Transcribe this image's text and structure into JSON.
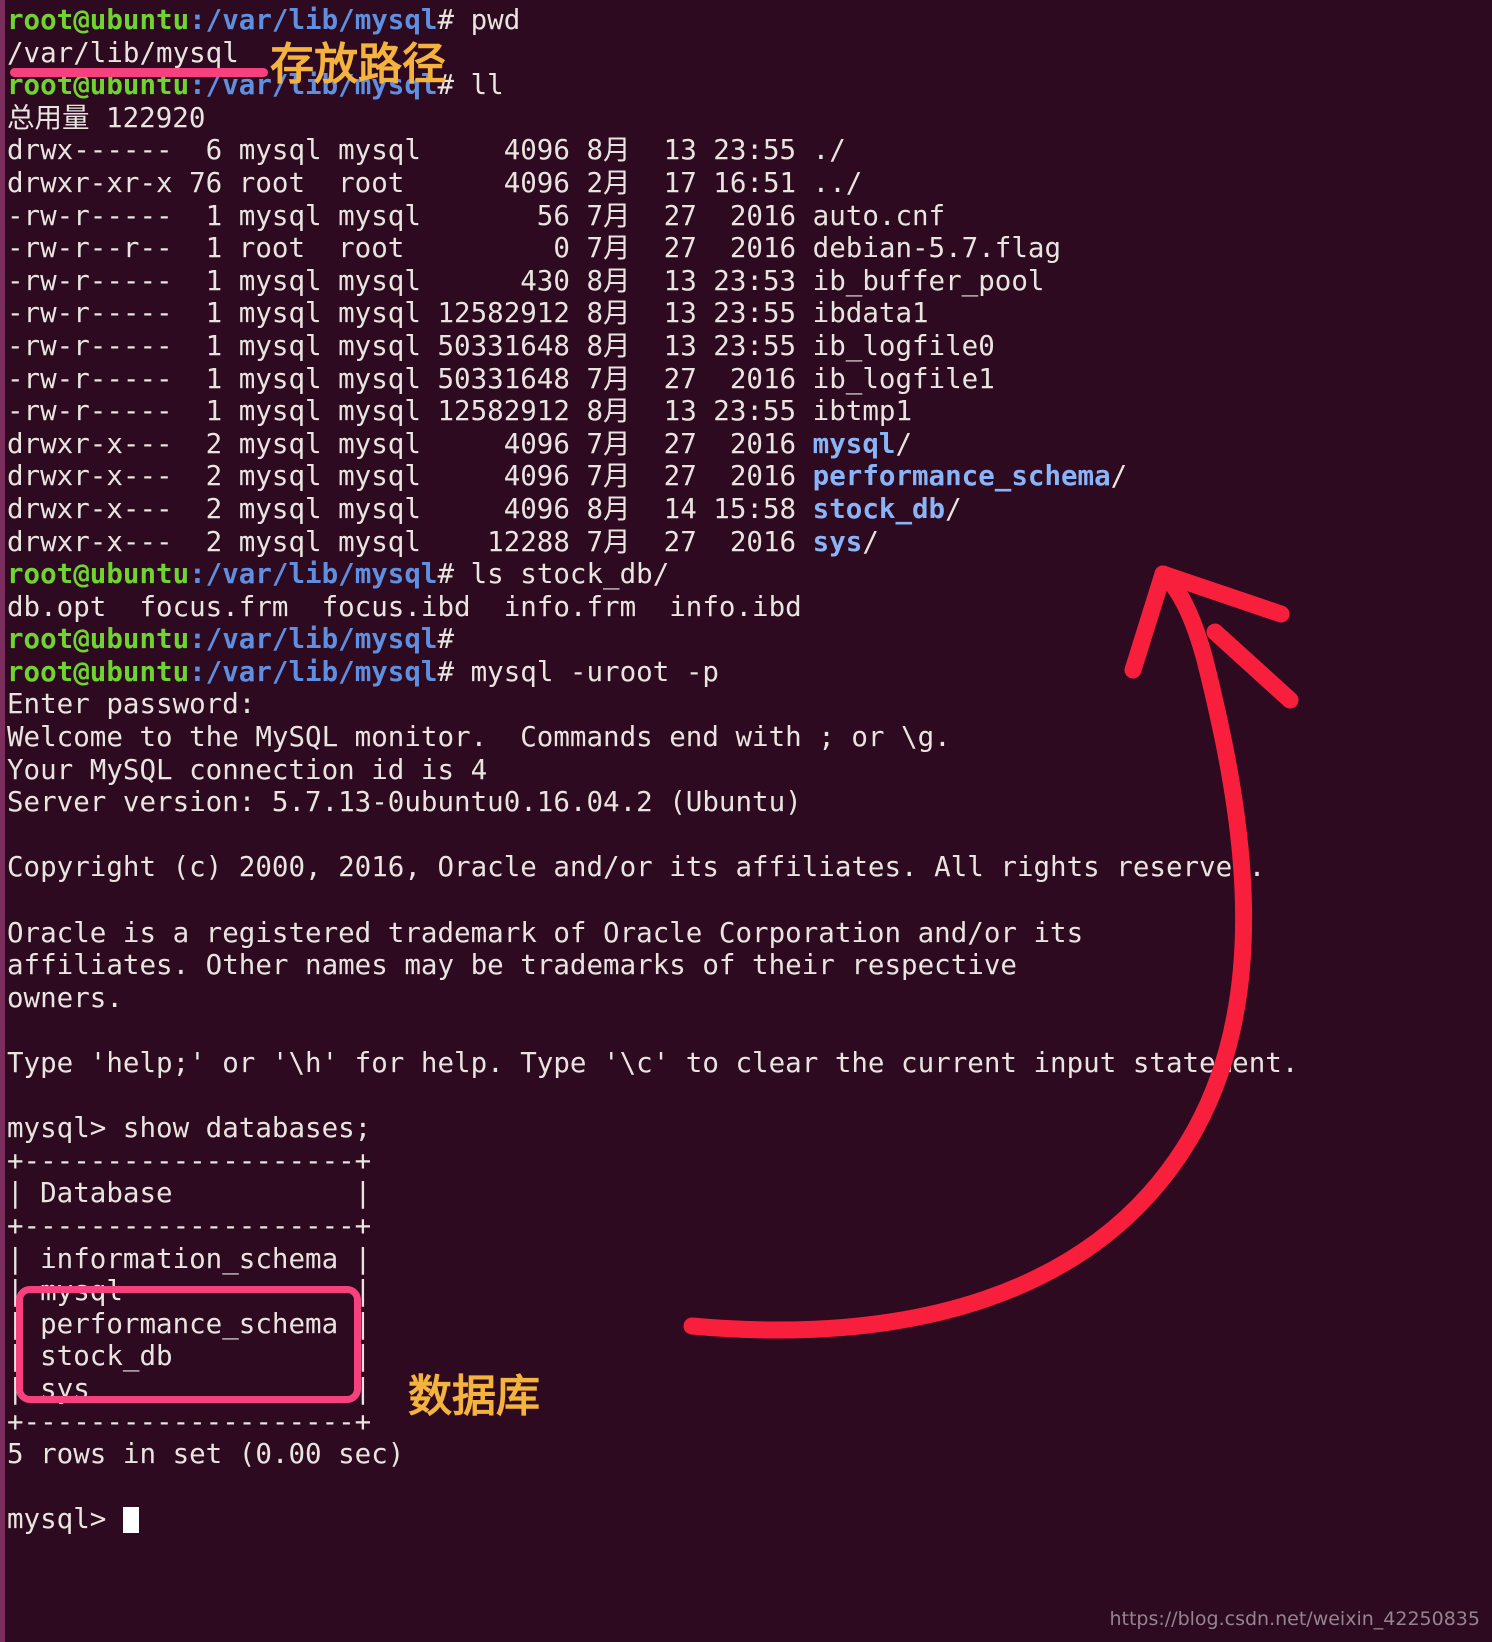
{
  "terminal": {
    "background_color": "#2d0a1f",
    "prompt_user_color": "#6fd430",
    "prompt_path_color": "#5f8fe0",
    "directory_color": "#8ab4f8",
    "text_color": "#e8e4e0",
    "prompt_user": "root@ubuntu",
    "prompt_path": ":/var/lib/mysql",
    "prompt_hash": "# ",
    "mysql_prompt": "mysql> ",
    "lines": [
      {
        "type": "prompt",
        "command": "pwd"
      },
      {
        "type": "out",
        "text": "/var/lib/mysql"
      },
      {
        "type": "prompt",
        "command": "ll"
      },
      {
        "type": "out",
        "text": "总用量 122920"
      },
      {
        "type": "ls",
        "perm": "drwx------",
        "links": " 6",
        "owner": "mysql",
        "group": "mysql",
        "size": "    4096",
        "month": "8月",
        "day": " 13",
        "time": "23:55",
        "name": "./",
        "dir": false
      },
      {
        "type": "ls",
        "perm": "drwxr-xr-x",
        "links": "76",
        "owner": "root ",
        "group": "root ",
        "size": "    4096",
        "month": "2月",
        "day": " 17",
        "time": "16:51",
        "name": "../",
        "dir": false
      },
      {
        "type": "ls",
        "perm": "-rw-r-----",
        "links": " 1",
        "owner": "mysql",
        "group": "mysql",
        "size": "      56",
        "month": "7月",
        "day": " 27",
        "time": " 2016",
        "name": "auto.cnf",
        "dir": false
      },
      {
        "type": "ls",
        "perm": "-rw-r--r--",
        "links": " 1",
        "owner": "root ",
        "group": "root ",
        "size": "       0",
        "month": "7月",
        "day": " 27",
        "time": " 2016",
        "name": "debian-5.7.flag",
        "dir": false
      },
      {
        "type": "ls",
        "perm": "-rw-r-----",
        "links": " 1",
        "owner": "mysql",
        "group": "mysql",
        "size": "     430",
        "month": "8月",
        "day": " 13",
        "time": "23:53",
        "name": "ib_buffer_pool",
        "dir": false
      },
      {
        "type": "ls",
        "perm": "-rw-r-----",
        "links": " 1",
        "owner": "mysql",
        "group": "mysql",
        "size": "12582912",
        "month": "8月",
        "day": " 13",
        "time": "23:55",
        "name": "ibdata1",
        "dir": false
      },
      {
        "type": "ls",
        "perm": "-rw-r-----",
        "links": " 1",
        "owner": "mysql",
        "group": "mysql",
        "size": "50331648",
        "month": "8月",
        "day": " 13",
        "time": "23:55",
        "name": "ib_logfile0",
        "dir": false
      },
      {
        "type": "ls",
        "perm": "-rw-r-----",
        "links": " 1",
        "owner": "mysql",
        "group": "mysql",
        "size": "50331648",
        "month": "7月",
        "day": " 27",
        "time": " 2016",
        "name": "ib_logfile1",
        "dir": false
      },
      {
        "type": "ls",
        "perm": "-rw-r-----",
        "links": " 1",
        "owner": "mysql",
        "group": "mysql",
        "size": "12582912",
        "month": "8月",
        "day": " 13",
        "time": "23:55",
        "name": "ibtmp1",
        "dir": false
      },
      {
        "type": "ls",
        "perm": "drwxr-x---",
        "links": " 2",
        "owner": "mysql",
        "group": "mysql",
        "size": "    4096",
        "month": "7月",
        "day": " 27",
        "time": " 2016",
        "name": "mysql",
        "dir": true
      },
      {
        "type": "ls",
        "perm": "drwxr-x---",
        "links": " 2",
        "owner": "mysql",
        "group": "mysql",
        "size": "    4096",
        "month": "7月",
        "day": " 27",
        "time": " 2016",
        "name": "performance_schema",
        "dir": true
      },
      {
        "type": "ls",
        "perm": "drwxr-x---",
        "links": " 2",
        "owner": "mysql",
        "group": "mysql",
        "size": "    4096",
        "month": "8月",
        "day": " 14",
        "time": "15:58",
        "name": "stock_db",
        "dir": true
      },
      {
        "type": "ls",
        "perm": "drwxr-x---",
        "links": " 2",
        "owner": "mysql",
        "group": "mysql",
        "size": "   12288",
        "month": "7月",
        "day": " 27",
        "time": " 2016",
        "name": "sys",
        "dir": true
      },
      {
        "type": "prompt",
        "command": "ls stock_db/"
      },
      {
        "type": "out",
        "text": "db.opt  focus.frm  focus.ibd  info.frm  info.ibd"
      },
      {
        "type": "prompt",
        "command": ""
      },
      {
        "type": "prompt",
        "command": "mysql -uroot -p"
      },
      {
        "type": "out",
        "text": "Enter password:"
      },
      {
        "type": "out",
        "text": "Welcome to the MySQL monitor.  Commands end with ; or \\g."
      },
      {
        "type": "out",
        "text": "Your MySQL connection id is 4"
      },
      {
        "type": "out",
        "text": "Server version: 5.7.13-0ubuntu0.16.04.2 (Ubuntu)"
      },
      {
        "type": "out",
        "text": ""
      },
      {
        "type": "out",
        "text": "Copyright (c) 2000, 2016, Oracle and/or its affiliates. All rights reserved."
      },
      {
        "type": "out",
        "text": ""
      },
      {
        "type": "out",
        "text": "Oracle is a registered trademark of Oracle Corporation and/or its"
      },
      {
        "type": "out",
        "text": "affiliates. Other names may be trademarks of their respective"
      },
      {
        "type": "out",
        "text": "owners."
      },
      {
        "type": "out",
        "text": ""
      },
      {
        "type": "out",
        "text": "Type 'help;' or '\\h' for help. Type '\\c' to clear the current input statement."
      },
      {
        "type": "out",
        "text": ""
      },
      {
        "type": "mysql",
        "command": "show databases;"
      },
      {
        "type": "out",
        "text": "+--------------------+"
      },
      {
        "type": "out",
        "text": "| Database           |"
      },
      {
        "type": "out",
        "text": "+--------------------+"
      },
      {
        "type": "out",
        "text": "| information_schema |"
      },
      {
        "type": "out",
        "text": "| mysql              |"
      },
      {
        "type": "out",
        "text": "| performance_schema |"
      },
      {
        "type": "out",
        "text": "| stock_db           |"
      },
      {
        "type": "out",
        "text": "| sys                |"
      },
      {
        "type": "out",
        "text": "+--------------------+"
      },
      {
        "type": "out",
        "text": "5 rows in set (0.00 sec)"
      },
      {
        "type": "out",
        "text": ""
      },
      {
        "type": "cursor",
        "text": ""
      }
    ]
  },
  "annotations": {
    "color_orange": "#f3b33d",
    "color_pink": "#f7417f",
    "color_red": "#f81f3c",
    "path_label": "存放路径",
    "database_label": "数据库",
    "underline_name": "pink-underline-under-path",
    "box_name": "pink-highlight-box-databases",
    "arrow_name": "red-curved-arrow"
  },
  "watermark": {
    "text": "https://blog.csdn.net/weixin_42250835"
  }
}
